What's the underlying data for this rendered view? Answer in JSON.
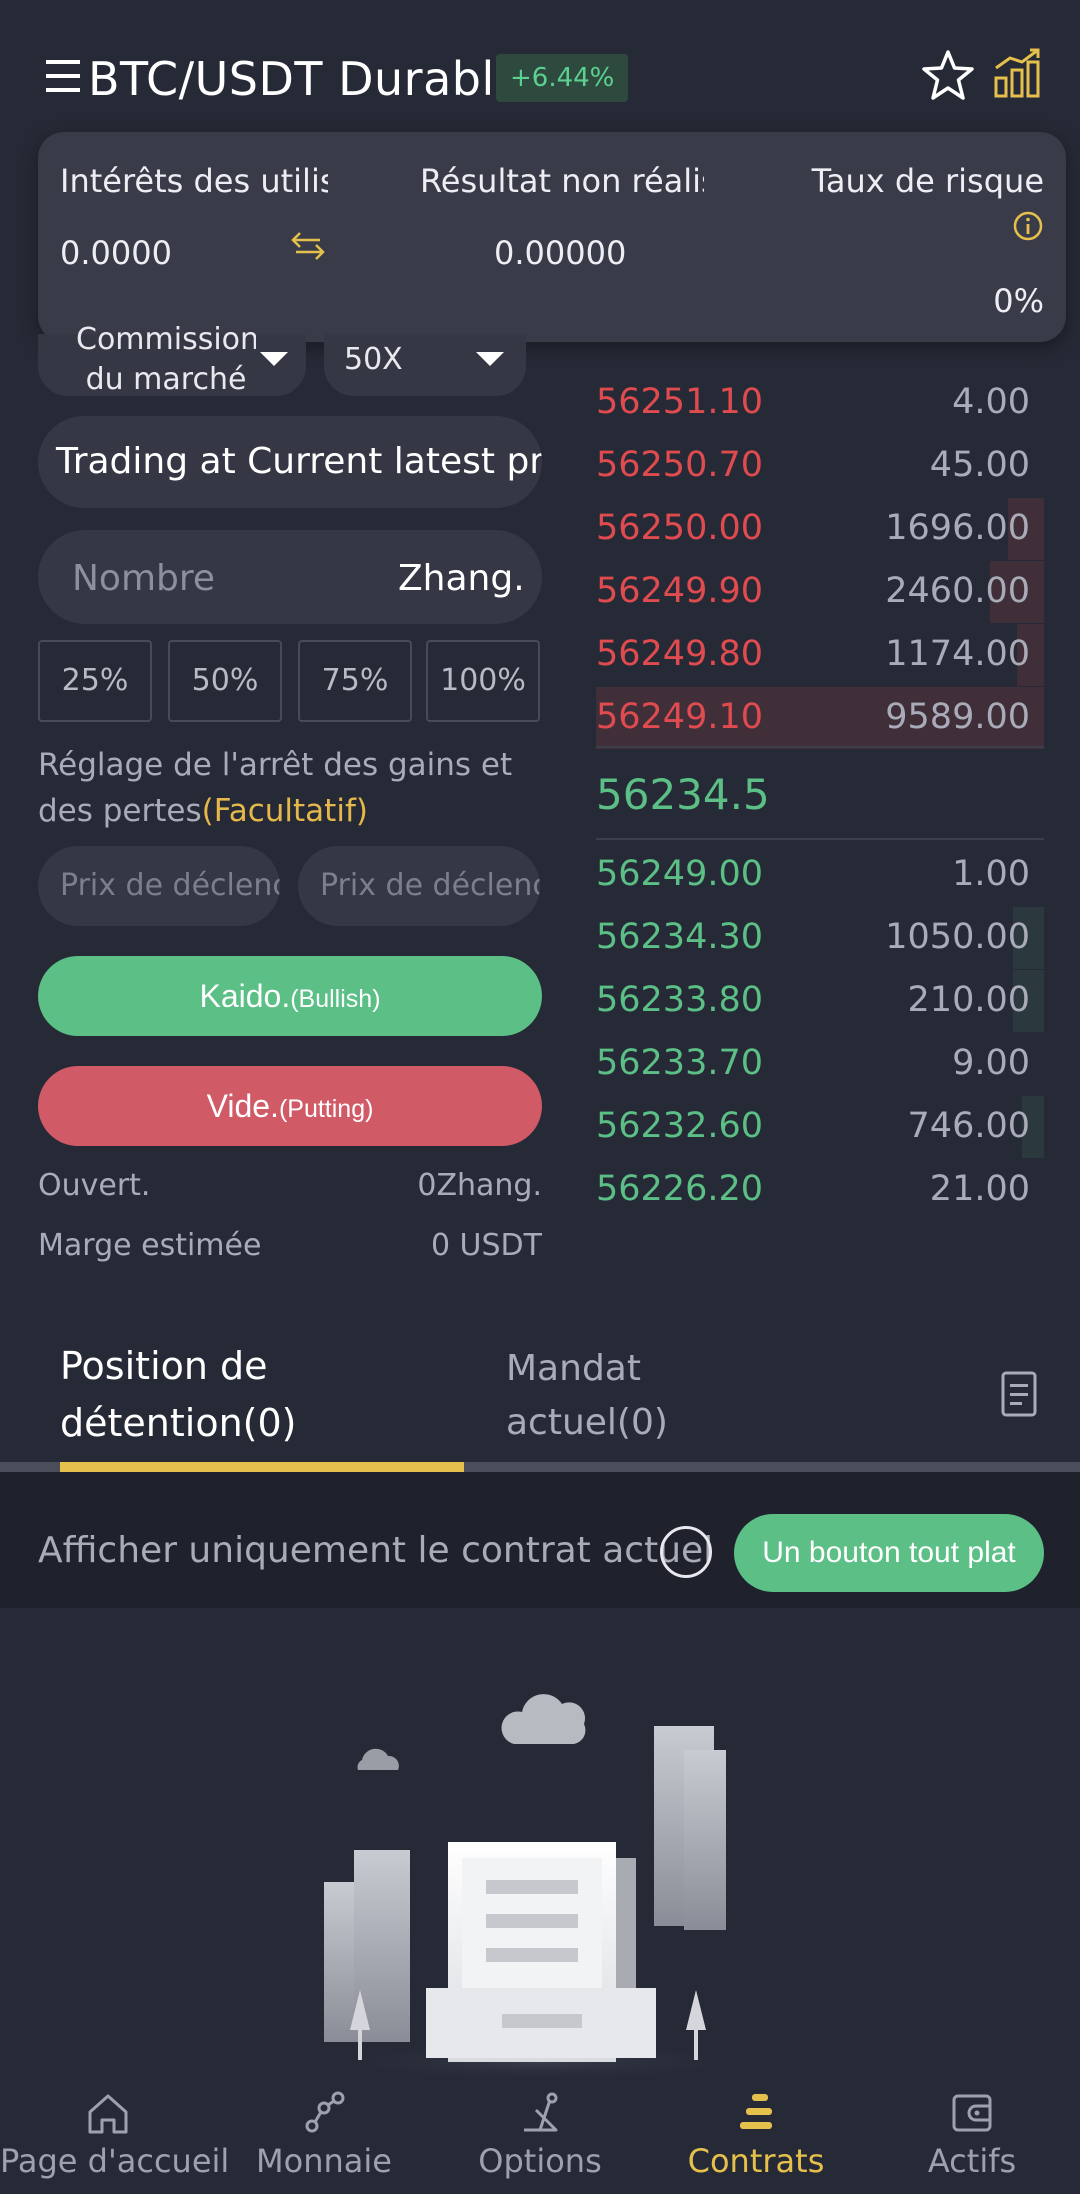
{
  "header": {
    "pair_title": "BTC/USDT Durable",
    "change_pct": "+6.44%"
  },
  "stats": {
    "interest_label": "Intérêts des utilisateurs",
    "interest_value": "0.0000",
    "unrealized_label": "Résultat non réalisé",
    "unrealized_value": "0.00000",
    "risk_label": "Taux de risque",
    "risk_value": "0%"
  },
  "order_form": {
    "order_type_line1": "Commission",
    "order_type_line2": "du marché",
    "leverage": "50X",
    "price_mode": "Trading at Current latest price",
    "amount_placeholder": "Nombre",
    "amount_unit": "Zhang.",
    "pct_buttons": [
      "25%",
      "50%",
      "75%",
      "100%"
    ],
    "tpsl_label": "Réglage de l'arrêt des gains et des pertes",
    "tpsl_optional": "(Facultatif)",
    "trigger_placeholder_1": "Prix de déclenchement",
    "trigger_placeholder_2": "Prix de déclenchement",
    "long_main": "Kaido.",
    "long_sub": "(Bullish)",
    "short_main": "Vide.",
    "short_sub": "(Putting)",
    "open_label": "Ouvert.",
    "open_value": "0Zhang.",
    "margin_label": "Marge estimée",
    "margin_value": "0 USDT"
  },
  "order_book": {
    "asks": [
      {
        "price": "56251.10",
        "qty": "4.00",
        "depth": 0.0
      },
      {
        "price": "56250.70",
        "qty": "45.00",
        "depth": 0.0
      },
      {
        "price": "56250.00",
        "qty": "1696.00",
        "depth": 0.08
      },
      {
        "price": "56249.90",
        "qty": "2460.00",
        "depth": 0.12
      },
      {
        "price": "56249.80",
        "qty": "1174.00",
        "depth": 0.06
      },
      {
        "price": "56249.10",
        "qty": "9589.00",
        "depth": 1.0
      }
    ],
    "mid_price": "56234.5",
    "bids": [
      {
        "price": "56249.00",
        "qty": "1.00",
        "depth": 0.0
      },
      {
        "price": "56234.30",
        "qty": "1050.00",
        "depth": 0.07
      },
      {
        "price": "56233.80",
        "qty": "210.00",
        "depth": 0.07
      },
      {
        "price": "56233.70",
        "qty": "9.00",
        "depth": 0.0
      },
      {
        "price": "56232.60",
        "qty": "746.00",
        "depth": 0.05
      },
      {
        "price": "56226.20",
        "qty": "21.00",
        "depth": 0.0
      }
    ]
  },
  "tabs": {
    "positions_line1": "Position de",
    "positions_line2": "détention(0)",
    "orders_line1": "Mandat",
    "orders_line2": "actuel(0)"
  },
  "filter": {
    "label": "Afficher uniquement le contrat actuel",
    "flat_button": "Un bouton tout plat"
  },
  "nav": {
    "items": [
      {
        "label": "Page d'accueil",
        "icon": "home-icon"
      },
      {
        "label": "Monnaie",
        "icon": "currency-icon"
      },
      {
        "label": "Options",
        "icon": "options-icon"
      },
      {
        "label": "Contrats",
        "icon": "contracts-icon"
      },
      {
        "label": "Actifs",
        "icon": "wallet-icon"
      }
    ],
    "active_index": 3
  },
  "colors": {
    "background": "#262a36",
    "accent_yellow": "#e6c04c",
    "up_green": "#5bbf86",
    "down_red": "#e04b4f"
  }
}
